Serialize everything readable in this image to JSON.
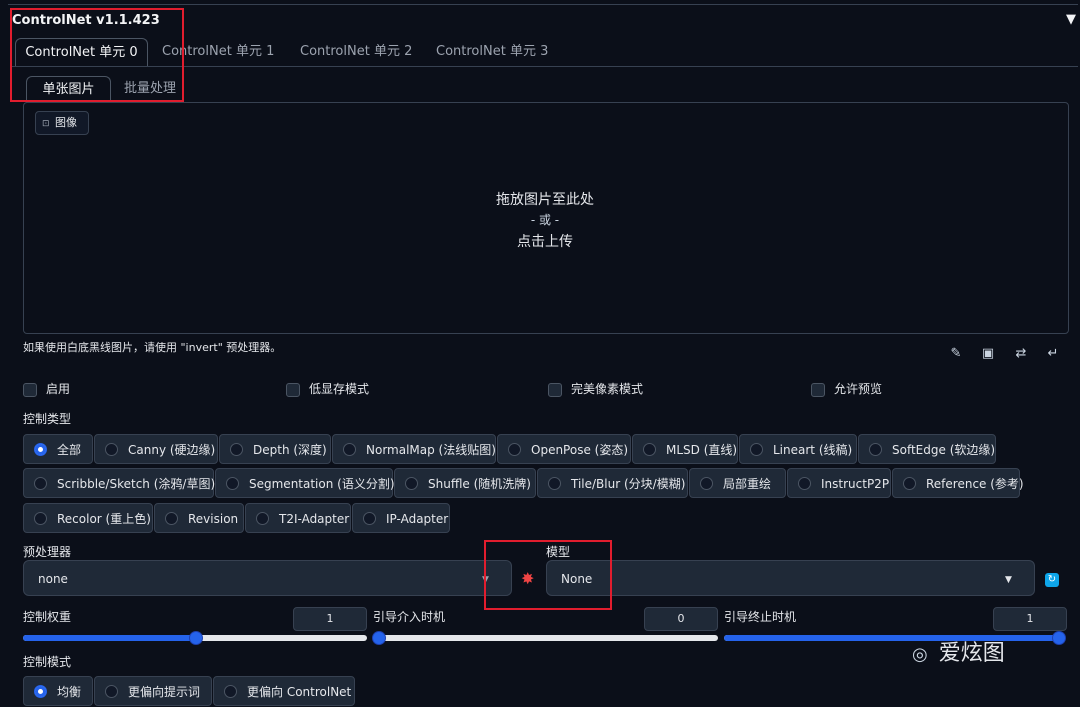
{
  "header": {
    "title": "ControlNet v1.1.423",
    "collapse_icon": "▼"
  },
  "unit_tabs": [
    "ControlNet 单元 0",
    "ControlNet 单元 1",
    "ControlNet 单元 2",
    "ControlNet 单元 3"
  ],
  "image_tabs": [
    "单张图片",
    "批量处理"
  ],
  "dropzone": {
    "chip_label": "图像",
    "line1": "拖放图片至此处",
    "line2": "- 或 -",
    "line3": "点击上传"
  },
  "hint": "如果使用白底黑线图片，请使用 \"invert\" 预处理器。",
  "checkboxes": [
    "启用",
    "低显存模式",
    "完美像素模式",
    "允许预览"
  ],
  "control_type": {
    "label": "控制类型",
    "options": [
      "全部",
      "Canny (硬边缘)",
      "Depth (深度)",
      "NormalMap (法线贴图)",
      "OpenPose (姿态)",
      "MLSD (直线)",
      "Lineart (线稿)",
      "SoftEdge (软边缘)",
      "Scribble/Sketch (涂鸦/草图)",
      "Segmentation (语义分割)",
      "Shuffle (随机洗牌)",
      "Tile/Blur (分块/模糊)",
      "局部重绘",
      "InstructP2P",
      "Reference (参考)",
      "Recolor (重上色)",
      "Revision",
      "T2I-Adapter",
      "IP-Adapter"
    ],
    "selected": "全部"
  },
  "preprocessor": {
    "label": "预处理器",
    "value": "none"
  },
  "model": {
    "label": "模型",
    "value": "None"
  },
  "sliders": [
    {
      "label": "控制权重",
      "value": "1",
      "fraction": 0.5
    },
    {
      "label": "引导介入时机",
      "value": "0",
      "fraction": 0.0
    },
    {
      "label": "引导终止时机",
      "value": "1",
      "fraction": 1.0
    }
  ],
  "control_mode": {
    "label": "控制模式",
    "options": [
      "均衡",
      "更偏向提示词",
      "更偏向 ControlNet"
    ],
    "selected": "均衡"
  },
  "watermark": "爱炫图",
  "colors": {
    "background": "#0b0f19",
    "accent": "#2563eb",
    "highlight": "#e11d2e"
  }
}
